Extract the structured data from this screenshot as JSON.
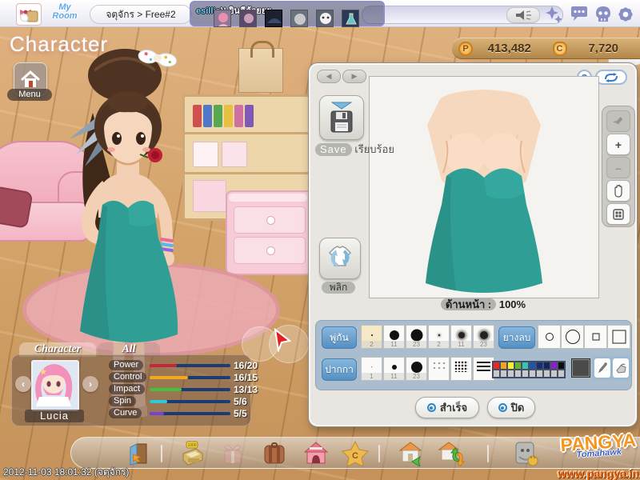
{
  "topbar": {
    "logo_line1": "My",
    "logo_line2": "Room",
    "location": "จตุจักร > Free#2",
    "chat": {
      "name": "esillia",
      "message": ")! ยินดีด้วยยย"
    },
    "icons": [
      "announcement",
      "sparkles",
      "chat-bubble",
      "skull",
      "settings-gear"
    ]
  },
  "hud": {
    "title": "Character",
    "menu_label": "Menu",
    "timestamp": "2012-11-03 18:01:32 (จตุจักร)"
  },
  "currency": {
    "pang_letter": "P",
    "pang_amount": "413,482",
    "cookie_letter": "C",
    "cookie_amount": "7,720"
  },
  "paint_panel": {
    "save_label": "Save",
    "save_note": "เรียบร้อย",
    "flip_label": "พลิก",
    "front_label": "ด้านหน้า :",
    "front_value": "100%",
    "brush_label": "พู่กัน",
    "pen_label": "ปากกา",
    "eraser_label": "ยางลบ",
    "brush_sizes": [
      "2",
      "11",
      "23",
      "2",
      "11",
      "23"
    ],
    "pen_sizes": [
      "1",
      "11",
      "23"
    ],
    "palette_row1": [
      "#ea2a1e",
      "#f4a41c",
      "#f8ef2f",
      "#68b22c",
      "#38c4ae",
      "#1e55a4",
      "#182f6e",
      "#13265c",
      "#8c20c8",
      "#0c0c0c"
    ],
    "current_color": "#4b4b4b",
    "done_label": "สำเร็จ",
    "close_label": "ปิด",
    "help_glyph": "?"
  },
  "character_panel": {
    "tab_character": "Character",
    "tab_all": "All",
    "name": "Lucia",
    "stats": [
      {
        "label": "Power",
        "value": "16/20",
        "color": "#c42838",
        "pct": 34
      },
      {
        "label": "Control",
        "value": "16/15",
        "color": "#f2a81e",
        "pct": 48
      },
      {
        "label": "Impact",
        "value": "13/13",
        "color": "#44c23c",
        "pct": 40
      },
      {
        "label": "Spin",
        "value": "5/6",
        "color": "#30c8d8",
        "pct": 22
      },
      {
        "label": "Curve",
        "value": "5/5",
        "color": "#7a40d8",
        "pct": 18
      }
    ]
  },
  "footer": {
    "register_tag": "1000",
    "cookie_letter": "C",
    "logo_top": "PANGYA",
    "logo_sub": "Tomahawk",
    "site_url": "www.pangya.in.th",
    "toolbar_icons": [
      "exit-door",
      "cash-register",
      "gift",
      "luggage",
      "pet-house",
      "star-cookie",
      "enter-room",
      "change-room",
      "plug"
    ]
  }
}
